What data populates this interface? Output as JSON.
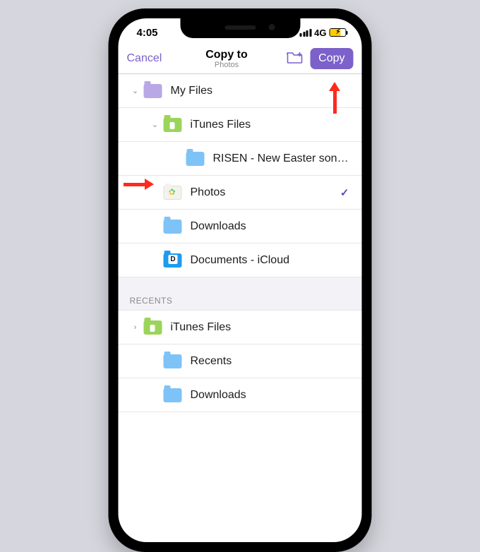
{
  "status": {
    "time": "4:05",
    "network": "4G"
  },
  "nav": {
    "cancel": "Cancel",
    "title": "Copy to",
    "subtitle": "Photos",
    "copy": "Copy"
  },
  "tree": {
    "my_files": "My Files",
    "itunes": "iTunes Files",
    "risen": "RISEN - New Easter song by...",
    "photos": "Photos",
    "downloads": "Downloads",
    "icloud": "Documents - iCloud"
  },
  "sections": {
    "recents": "RECENTS"
  },
  "recents": {
    "itunes": "iTunes Files",
    "recents": "Recents",
    "downloads": "Downloads"
  }
}
